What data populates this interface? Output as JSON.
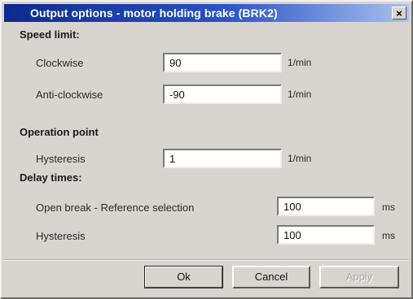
{
  "window": {
    "title": "Output options - motor holding brake (BRK2)",
    "close_glyph": "×"
  },
  "speed_limit": {
    "heading": "Speed limit:",
    "clockwise": {
      "label": "Clockwise",
      "value": "90",
      "unit": "1/min"
    },
    "anticlockwise": {
      "label": "Anti-clockwise",
      "value": "-90",
      "unit": "1/min"
    }
  },
  "operation_point": {
    "heading": "Operation point",
    "hysteresis": {
      "label": "Hysteresis",
      "value": "1",
      "unit": "1/min"
    }
  },
  "delay_times": {
    "heading": "Delay times:",
    "open_break": {
      "label": "Open break - Reference selection",
      "value": "100",
      "unit": "ms"
    },
    "hysteresis": {
      "label": "Hysteresis",
      "value": "100",
      "unit": "ms"
    }
  },
  "buttons": {
    "ok": "Ok",
    "cancel": "Cancel",
    "apply": "Apply"
  },
  "colors": {
    "titlebar_start": "#0c2a8c",
    "titlebar_end": "#a9c2ee",
    "dialog_bg": "#d8d5d1"
  }
}
